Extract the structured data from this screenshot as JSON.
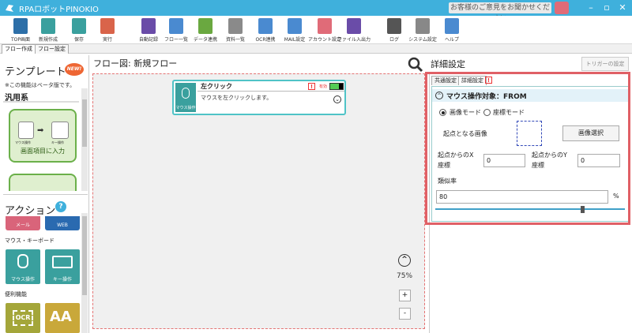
{
  "app": {
    "title": "RPAロボットPINOKIO",
    "feedback": "お客様のご意見をお聞かせください",
    "window_min": "–",
    "window_max": "▫",
    "window_close": "✕"
  },
  "toolbar": [
    {
      "label": "TOP画面",
      "color": "#2d6fa8"
    },
    {
      "label": "新規作成",
      "color": "#3aa09e"
    },
    {
      "label": "保存",
      "color": "#3aa09e"
    },
    {
      "label": "実行",
      "color": "#d9644a"
    },
    {
      "label": "自動記録",
      "color": "#6a4ca8"
    },
    {
      "label": "フロー一覧",
      "color": "#4a8ad0"
    },
    {
      "label": "データ連携",
      "color": "#6aa840"
    },
    {
      "label": "資料一覧",
      "color": "#8a8a8a"
    },
    {
      "label": "OCR連携",
      "color": "#4a8ad0"
    },
    {
      "label": "MAIL設定",
      "color": "#4a8ad0"
    },
    {
      "label": "アカウント設定",
      "color": "#e06b78"
    },
    {
      "label": "ファイル入出力",
      "color": "#6a4ca8"
    },
    {
      "label": "ログ",
      "color": "#555555"
    },
    {
      "label": "システム設定",
      "color": "#888888"
    },
    {
      "label": "ヘルプ",
      "color": "#4a8ad0"
    }
  ],
  "tabs": {
    "flow_create": "フロー作成",
    "flow_settings": "フロー設定"
  },
  "left": {
    "template_title": "テンプレート",
    "new_badge": "NEW!",
    "beta_note": "※この機能はベータ版です。",
    "category": "汎用系",
    "card1_label": "画面項目に入力",
    "card1_mouse": "マウス操作",
    "card1_key": "キー操作",
    "action_title": "アクション",
    "help": "?",
    "tile_mail": "メール",
    "tile_web": "WEB",
    "section_mouse": "マウス・キーボード",
    "tile_mouse": "マウス操作",
    "tile_key": "キー操作",
    "section_util": "便利機能",
    "tile_ocr": "OCR",
    "tile_aa": "AA"
  },
  "flow": {
    "header": "フロー図:  新規フロー",
    "node_title": "左クリック",
    "node_desc": "マウスを左クリックします。",
    "node_icon_label": "マウス操作",
    "node_warn": "!",
    "node_kbd": "有効",
    "node_chev": "⌄",
    "zoom_up": "^",
    "zoom": "75%",
    "zoom_plus": "+",
    "zoom_minus": "-"
  },
  "detail": {
    "header": "詳細設定",
    "trigger": "トリガーの設定",
    "tab_common": "共通設定",
    "tab_detail": "詳細設定",
    "tab_warn": "!",
    "section_title": "マウス操作対象：FROM",
    "section_chev": "^",
    "mode_image": "画像モード",
    "mode_coord": "座標モード",
    "base_image": "起点となる画像",
    "select_image": "画像選択",
    "x_label1": "起点からのX",
    "x_label2": "座標",
    "x_value": "0",
    "y_label1": "起点からのY",
    "y_label2": "座標",
    "y_value": "0",
    "similarity": "類似率",
    "similarity_value": "80",
    "percent": "%",
    "slider_value": 0.8
  },
  "colors": {
    "accent": "#3fb0dc",
    "highlight": "#e06066",
    "node": "#4fc3c7"
  }
}
